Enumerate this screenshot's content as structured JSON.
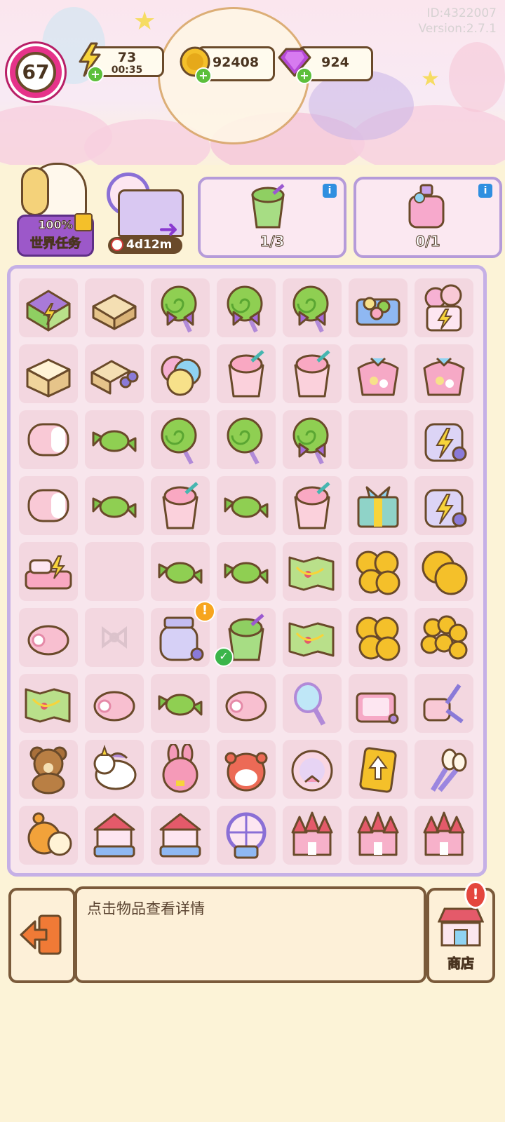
{
  "hud": {
    "game_id": "ID:4322007",
    "version": "Version:2.7.1",
    "level": "67",
    "energy": "73",
    "energy_timer": "00:35",
    "coins": "92408",
    "gems": "924"
  },
  "panels": {
    "world_quest_progress": "100%",
    "world_quest_label": "世界任务",
    "park_timer": "4d12m",
    "orders": [
      {
        "count": "1/3",
        "icon": "matcha-drink-icon"
      },
      {
        "count": "0/1",
        "icon": "perfume-bottle-icon"
      }
    ]
  },
  "board": {
    "rows": [
      [
        "house-building",
        "cardboard-box",
        "green-lollipop-ribbon",
        "green-lollipop-ribbon",
        "green-lollipop-ribbon",
        "candy-gift-tray",
        "balloon-generator"
      ],
      [
        "open-box",
        "box-scissors",
        "cotton-candy",
        "pink-milkshake",
        "pink-milkshake",
        "candy-bag",
        "candy-bag"
      ],
      [
        "pink-marshmallow",
        "green-candy",
        "green-lollipop",
        "green-lollipop",
        "green-lollipop-ribbon",
        "empty",
        "energy-jar"
      ],
      [
        "pink-marshmallow",
        "green-candy",
        "pink-milkshake",
        "green-candy",
        "pink-milkshake",
        "gift-box",
        "energy-jar"
      ],
      [
        "bed-generator",
        "empty",
        "green-candy",
        "green-candy",
        "treasure-map",
        "gold-coins",
        "gold-coins-large"
      ],
      [
        "roll-cake",
        "empty-bow",
        "glass-jar",
        "matcha-drink",
        "treasure-map",
        "gold-coins",
        "gold-coin-pile"
      ],
      [
        "treasure-map",
        "roll-cake",
        "green-candy",
        "roll-cake",
        "hand-mirror",
        "compact-case",
        "lint-roller"
      ],
      [
        "teddy-bear",
        "unicorn-plush",
        "bunny-plush",
        "hamster-plush",
        "powder-puff",
        "upgrade-card",
        "makeup-brushes"
      ],
      [
        "orange-squirrel",
        "carousel",
        "carousel",
        "ferris-wheel",
        "pink-castle",
        "pink-castle",
        "pink-castle"
      ]
    ]
  },
  "bottom": {
    "detail_text": "点击物品查看详情",
    "shop_label": "商店",
    "shop_alert": "!"
  }
}
